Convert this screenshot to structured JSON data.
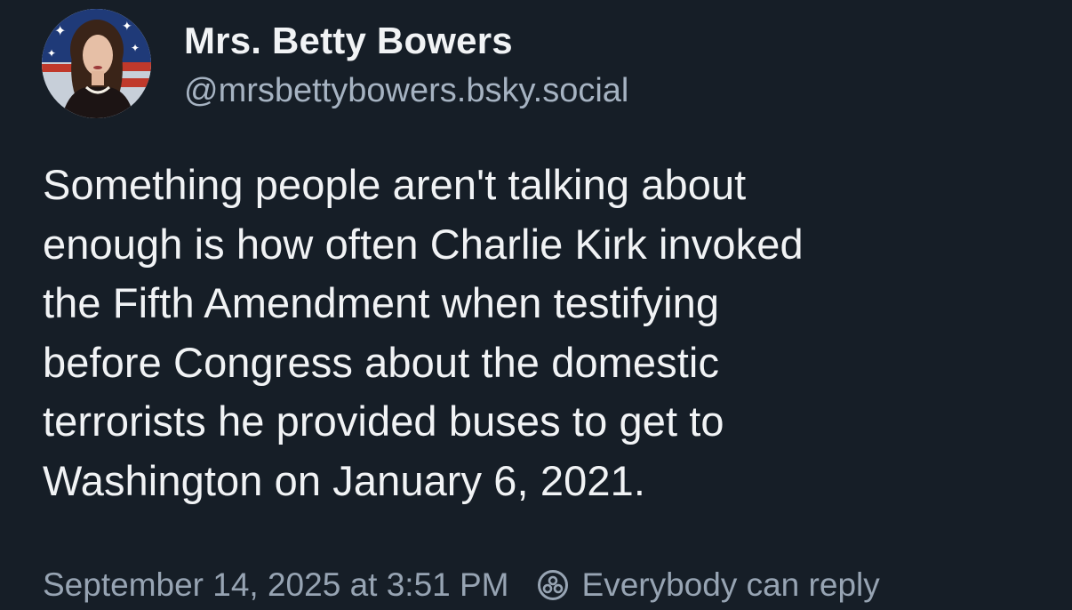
{
  "author": {
    "display_name": "Mrs. Betty Bowers",
    "handle": "@mrsbettybowers.bsky.social"
  },
  "post": {
    "text_lines": [
      "Something people aren't talking about",
      "enough is how often Charlie Kirk invoked",
      "the Fifth Amendment when testifying",
      "before Congress about the domestic",
      "terrorists he provided buses to get to",
      "Washington on January 6, 2021."
    ]
  },
  "meta": {
    "timestamp": "September 14, 2025 at 3:51 PM",
    "reply_setting": "Everybody can reply",
    "reply_icon": "reply-settings-icon"
  },
  "colors": {
    "background": "#161e27",
    "text": "#f1f3f5",
    "muted": "#97a4b3"
  }
}
